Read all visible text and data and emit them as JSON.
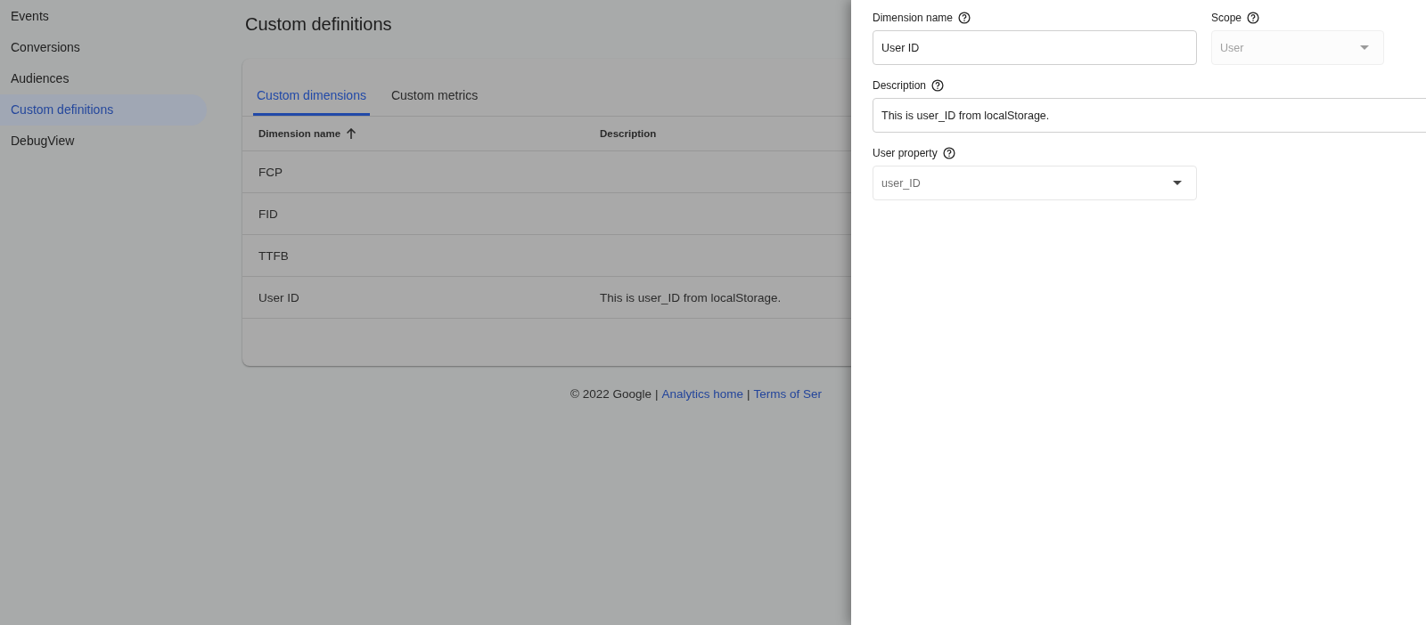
{
  "sidebar": {
    "items": [
      {
        "label": "Events",
        "selected": false
      },
      {
        "label": "Conversions",
        "selected": false
      },
      {
        "label": "Audiences",
        "selected": false
      },
      {
        "label": "Custom definitions",
        "selected": true
      },
      {
        "label": "DebugView",
        "selected": false
      }
    ]
  },
  "page_title": "Custom definitions",
  "tabs": [
    {
      "label": "Custom dimensions",
      "selected": true
    },
    {
      "label": "Custom metrics",
      "selected": false
    }
  ],
  "table": {
    "columns": [
      {
        "label": "Dimension name",
        "sorted": true
      },
      {
        "label": "Description",
        "sorted": false
      }
    ],
    "rows": [
      {
        "cells": [
          "FCP",
          ""
        ]
      },
      {
        "cells": [
          "FID",
          ""
        ]
      },
      {
        "cells": [
          "TTFB",
          ""
        ]
      },
      {
        "cells": [
          "User ID",
          "This is user_ID from localStorage."
        ]
      }
    ]
  },
  "footer": {
    "items": [
      {
        "kind": "text",
        "text": "© 2022 Google"
      },
      {
        "kind": "separator",
        "text": "|"
      },
      {
        "kind": "link",
        "text": "Analytics home"
      },
      {
        "kind": "separator",
        "text": "|"
      },
      {
        "kind": "link",
        "text": "Terms of Ser"
      }
    ]
  },
  "panel": {
    "fields": [
      {
        "kind": "text",
        "label": "Dimension name",
        "value": "User ID",
        "disabled": false
      },
      {
        "kind": "select",
        "label": "Scope",
        "value": "User",
        "disabled": true
      },
      {
        "kind": "text",
        "label": "Description",
        "value": "This is user_ID from localStorage.",
        "disabled": false
      },
      {
        "kind": "select",
        "label": "User property",
        "value": "user_ID",
        "disabled": false
      }
    ]
  }
}
